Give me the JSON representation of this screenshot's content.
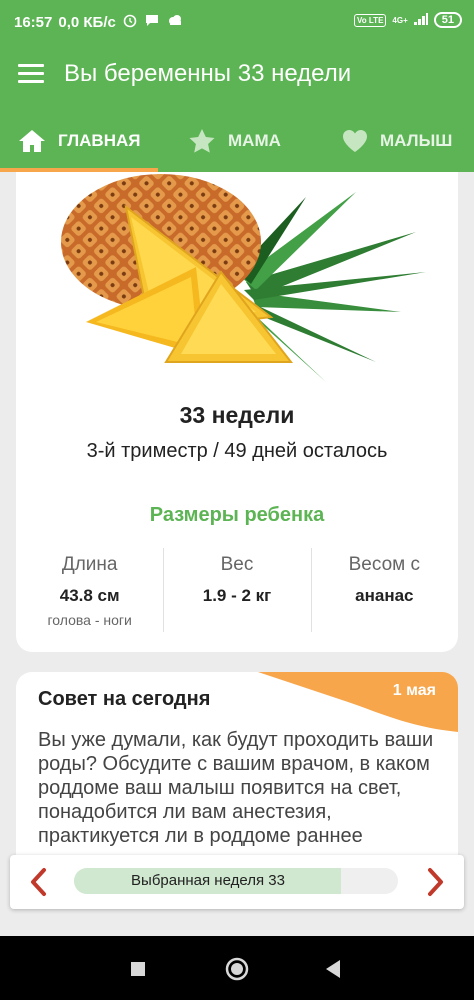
{
  "status_bar": {
    "time": "16:57",
    "net_speed": "0,0 КБ/с",
    "volte": "Vo LTE",
    "signal": "4G+",
    "battery": "51"
  },
  "app_bar": {
    "title": "Вы беременны 33 недели",
    "menu_icon": "hamburger-menu-icon"
  },
  "tabs": [
    {
      "label": "ГЛАВНАЯ",
      "icon": "home-icon",
      "active": true
    },
    {
      "label": "МАМА",
      "icon": "star-icon",
      "active": false
    },
    {
      "label": "МАЛЫШ",
      "icon": "heart-icon",
      "active": false
    }
  ],
  "week_card": {
    "image": "pineapple",
    "title": "33 недели",
    "subtitle": "3-й триместр / 49 дней осталось",
    "sizes_title": "Размеры ребенка",
    "stats": [
      {
        "label": "Длина",
        "value": "43.8 см",
        "note": "голова - ноги"
      },
      {
        "label": "Вес",
        "value": "1.9 - 2 кг",
        "note": ""
      },
      {
        "label": "Весом с",
        "value": "ананас",
        "note": ""
      }
    ]
  },
  "tip_card": {
    "title": "Совет на сегодня",
    "date": "1 мая",
    "text": "Вы уже думали, как будут проходить ваши роды? Обсудите с вашим врачом, в каком роддоме ваш малыш появится на свет, понадобится ли вам анестезия, практикуется ли в роддоме раннее"
  },
  "week_selector": {
    "label": "Выбранная неделя 33",
    "progress": 0.825,
    "prev_icon": "chevron-left-icon",
    "next_icon": "chevron-right-icon"
  },
  "colors": {
    "primary": "#5cb454",
    "accent": "#f7a64b",
    "arrow": "#c0392b"
  }
}
